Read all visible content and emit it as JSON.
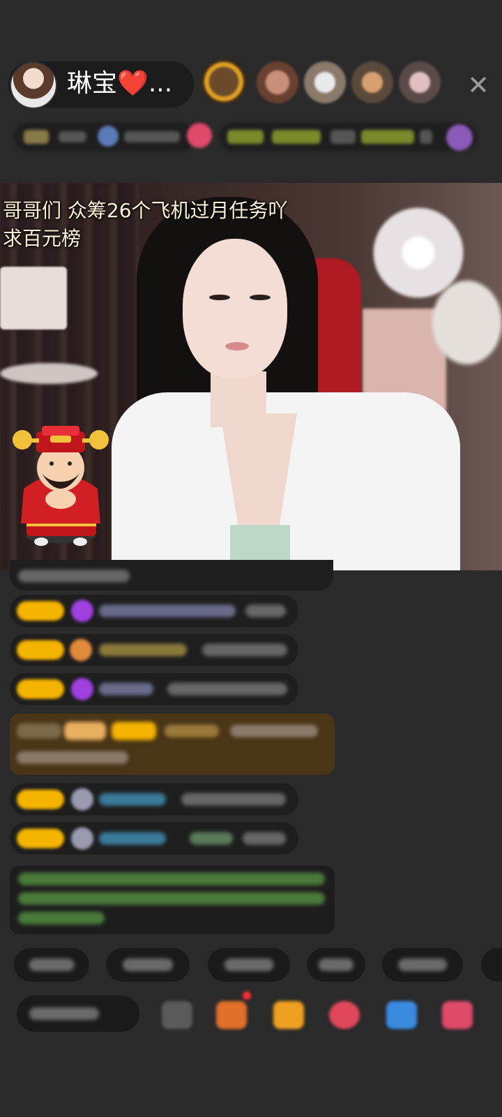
{
  "header": {
    "host_name": "琳宝❤️...",
    "close_icon": "close-icon"
  },
  "video": {
    "overlay_text_line1": "哥哥们 众筹26个飞机过月任务吖",
    "overlay_text_line2": "求百元榜"
  },
  "colors": {
    "background": "#2a2a2a",
    "badge": "#f5b400",
    "highlight": "#4a3516"
  }
}
